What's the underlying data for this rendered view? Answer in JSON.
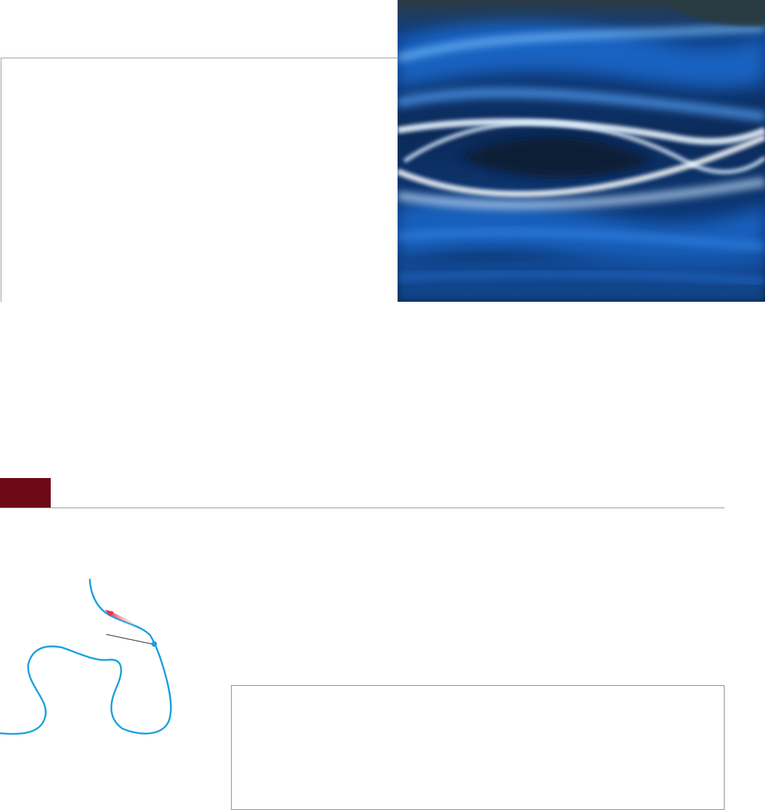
{
  "colors": {
    "section_tab": "#6e0a17",
    "rule": "#9a9a9a",
    "curve": "#1aa0e0",
    "arrow": "#e8344e",
    "art_dark": "#0c2a55",
    "art_blue": "#1e6fd8",
    "art_light": "#e8f4ff"
  },
  "icons": {
    "direction_arrow": "arrow-icon",
    "curve_point": "point-marker-icon"
  }
}
